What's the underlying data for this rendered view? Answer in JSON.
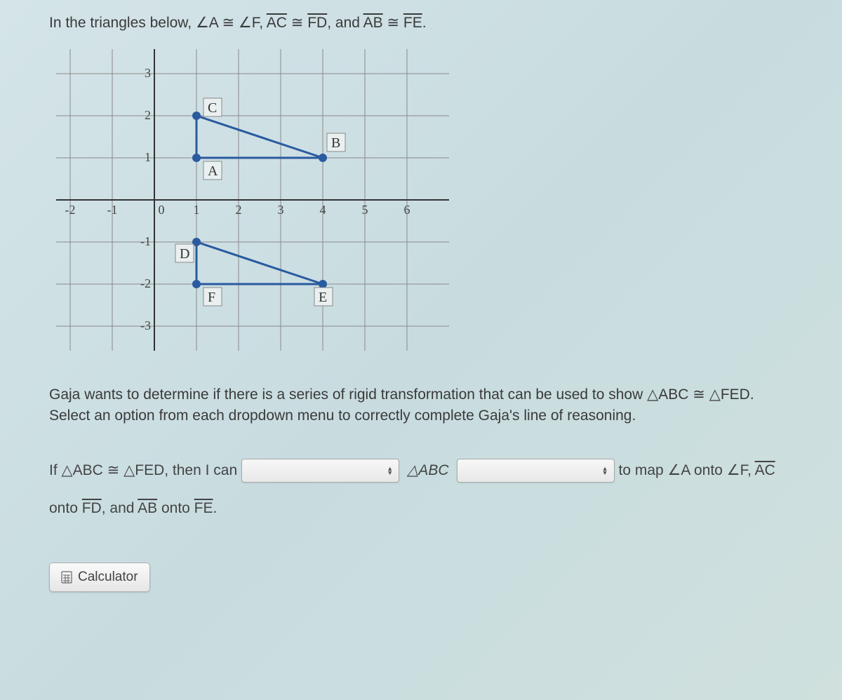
{
  "intro": {
    "prefix": "In the triangles below, ",
    "ang1a": "∠A",
    "cong": " ≅ ",
    "ang1b": "∠F",
    "sep1": ", ",
    "seg2a": "AC",
    "seg2b": "FD",
    "sep2": ", and ",
    "seg3a": "AB",
    "seg3b": "FE",
    "suffix": "."
  },
  "graph": {
    "x_ticks": [
      "-2",
      "-1",
      "0",
      "1",
      "2",
      "3",
      "4",
      "5",
      "6"
    ],
    "y_ticks": [
      "-3",
      "-2",
      "-1",
      "1",
      "2",
      "3"
    ],
    "labels": {
      "A": "A",
      "B": "B",
      "C": "C",
      "D": "D",
      "E": "E",
      "F": "F"
    }
  },
  "instruction": {
    "line1": "Gaja wants to determine if there is a series of rigid transformation that can be used to show △ABC ≅ △FED.",
    "line2": "Select an option from each dropdown menu to correctly complete Gaja's line of reasoning."
  },
  "sentence": {
    "part1": "If △ABC ≅ △FED, then I can",
    "middle": "△ABC",
    "tail": "to map ∠A onto ∠F, ",
    "tailseg": "AC",
    "part3_prefix": "onto ",
    "part3_seg1": "FD",
    "part3_mid": ", and ",
    "part3_seg2": "AB",
    "part3_mid2": " onto ",
    "part3_seg3": "FE",
    "part3_suffix": "."
  },
  "calculator_label": "Calculator"
}
